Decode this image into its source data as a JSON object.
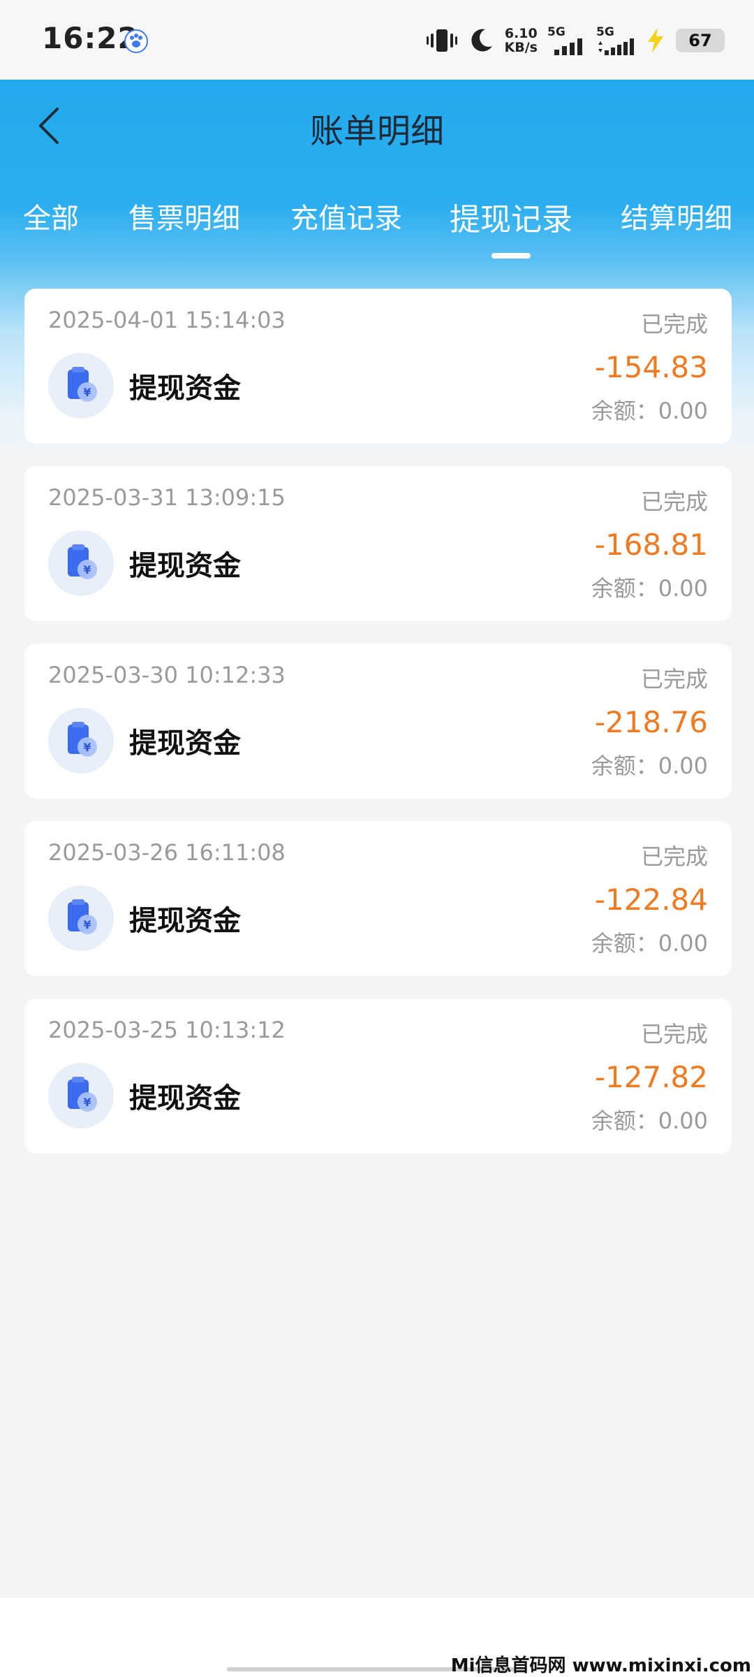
{
  "status_bar": {
    "time": "16:22",
    "net_speed_value": "6.10",
    "net_speed_unit": "KB/s",
    "sim1_label": "5G",
    "sim2_label": "5G",
    "battery": "67"
  },
  "header": {
    "title": "账单明细"
  },
  "tabs": [
    {
      "label": "全部"
    },
    {
      "label": "售票明细"
    },
    {
      "label": "充值记录"
    },
    {
      "label": "提现记录",
      "active": true
    },
    {
      "label": "结算明细"
    }
  ],
  "records": [
    {
      "time": "2025-04-01 15:14:03",
      "status": "已完成",
      "name": "提现资金",
      "amount": "-154.83",
      "balance": "余额：0.00"
    },
    {
      "time": "2025-03-31 13:09:15",
      "status": "已完成",
      "name": "提现资金",
      "amount": "-168.81",
      "balance": "余额：0.00"
    },
    {
      "time": "2025-03-30 10:12:33",
      "status": "已完成",
      "name": "提现资金",
      "amount": "-218.76",
      "balance": "余额：0.00"
    },
    {
      "time": "2025-03-26 16:11:08",
      "status": "已完成",
      "name": "提现资金",
      "amount": "-122.84",
      "balance": "余额：0.00"
    },
    {
      "time": "2025-03-25 10:13:12",
      "status": "已完成",
      "name": "提现资金",
      "amount": "-127.82",
      "balance": "余额：0.00"
    }
  ],
  "watermark": "Mi信息首码网 www.mixinxi.com",
  "colors": {
    "header_blue": "#22aaee",
    "amount_orange": "#ef7a1f",
    "icon_blue": "#3b6cf0"
  }
}
